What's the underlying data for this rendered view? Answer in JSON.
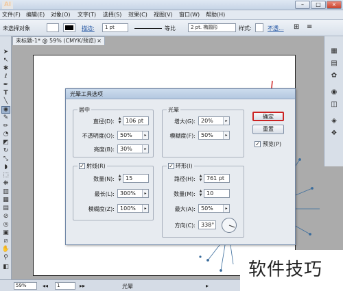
{
  "app": {
    "logo": "AI"
  },
  "menu": [
    "文件(F)",
    "编辑(E)",
    "对象(O)",
    "文字(T)",
    "选择(S)",
    "效果(C)",
    "视图(V)",
    "窗口(W)",
    "帮助(H)"
  ],
  "control_bar": {
    "selection_label": "未选择对象",
    "stroke_label": "描边:",
    "stroke_value": "1 pt",
    "ratio_label": "等比",
    "brush_value": "2 pt. 椭圆形",
    "style_label": "样式:",
    "opacity_label": "不透..."
  },
  "document": {
    "tab_title": "未标题-1* @ 59% (CMYK/预览)",
    "close": "×"
  },
  "status_bar": {
    "zoom": "59%",
    "page": "1",
    "tool_name": "光晕"
  },
  "watermark": "软件技巧",
  "dialog": {
    "title": "光晕工具选项",
    "center_group": {
      "title": "居中",
      "diameter_label": "直径(D):",
      "diameter_value": "106 pt",
      "opacity_label": "不透明度(O):",
      "opacity_value": "50%",
      "brightness_label": "亮度(B):",
      "brightness_value": "30%"
    },
    "halo_group": {
      "title": "光晕",
      "growth_label": "增大(G):",
      "growth_value": "20%",
      "fuzziness_label": "模糊度(F):",
      "fuzziness_value": "50%"
    },
    "rays_group": {
      "title": "射线(R)",
      "checked": true,
      "number_label": "数量(N):",
      "number_value": "15",
      "longest_label": "最长(L):",
      "longest_value": "300%",
      "fuzziness_label": "模糊度(Z):",
      "fuzziness_value": "100%"
    },
    "rings_group": {
      "title": "环形(I)",
      "checked": true,
      "path_label": "路径(H):",
      "path_value": "761 pt",
      "number_label": "数量(M):",
      "number_value": "10",
      "largest_label": "最大(A):",
      "largest_value": "50%",
      "direction_label": "方向(C):",
      "direction_value": "338°"
    },
    "ok_label": "确定",
    "reset_label": "重置",
    "preview_label": "预览(P)",
    "preview_checked": true
  },
  "colors": {
    "highlight": "#cc2222",
    "ray": "#3a6c9c"
  },
  "icons": {
    "tools": [
      "selection-tool-icon",
      "direct-selection-tool-icon",
      "magic-wand-icon",
      "lasso-icon",
      "pen-tool-icon",
      "type-tool-icon",
      "line-tool-icon",
      "flare-tool-icon",
      "paintbrush-icon",
      "pencil-icon",
      "blob-brush-icon",
      "eraser-icon",
      "rotate-icon",
      "scale-icon",
      "warp-icon",
      "free-transform-icon",
      "symbol-sprayer-icon",
      "graph-icon",
      "mesh-icon",
      "gradient-icon",
      "eyedropper-icon",
      "blend-icon",
      "live-paint-icon",
      "slice-icon",
      "hand-icon",
      "zoom-icon"
    ],
    "panels": [
      "color-panel-icon",
      "swatches-icon",
      "brushes-icon",
      "symbols-icon",
      "graphic-styles-icon",
      "appearance-icon",
      "layers-icon"
    ]
  }
}
